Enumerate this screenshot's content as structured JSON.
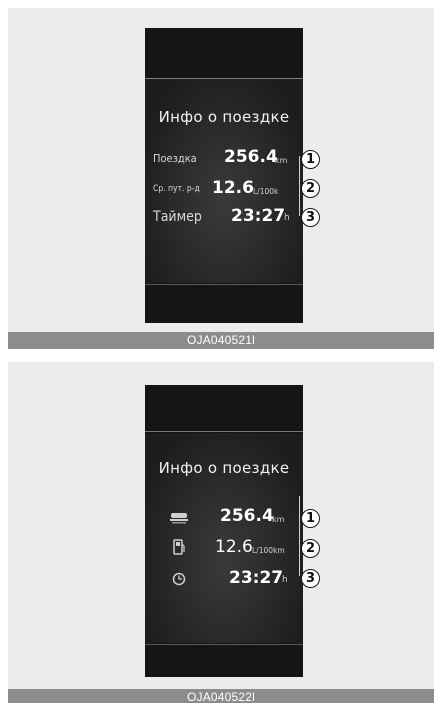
{
  "figure1": {
    "title": "Инфо о поездке",
    "rows": [
      {
        "label": "Поездка",
        "value": "256.4",
        "unit": "km",
        "number": "1"
      },
      {
        "label": "Ср. пут. р-д",
        "value": "12.6",
        "unit": "L/100k",
        "number": "2"
      },
      {
        "label": "Таймер",
        "value": "23:27",
        "unit": "h",
        "number": "3"
      }
    ],
    "caption": "OJA040521l"
  },
  "figure2": {
    "title": "Инфо о поездке",
    "rows": [
      {
        "icon": "car-distance-icon",
        "value": "256.4",
        "unit": "km",
        "number": "1"
      },
      {
        "icon": "fuel-pump-icon",
        "value": "12.6",
        "unit": "L/100km",
        "number": "2"
      },
      {
        "icon": "clock-icon",
        "value": "23:27",
        "unit": "h",
        "number": "3"
      }
    ],
    "caption": "OJA040522l"
  }
}
